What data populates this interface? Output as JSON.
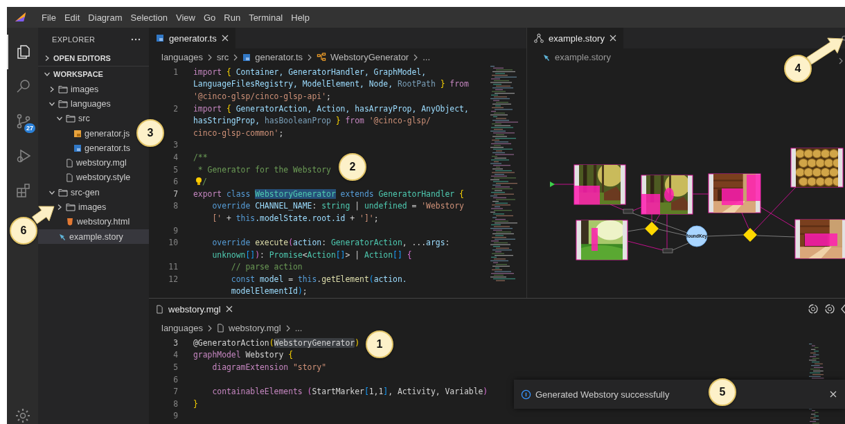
{
  "menu": [
    "File",
    "Edit",
    "Diagram",
    "Selection",
    "View",
    "Go",
    "Run",
    "Terminal",
    "Help"
  ],
  "activity": [
    {
      "kind": "files",
      "selected": true
    },
    {
      "kind": "search",
      "selected": false
    },
    {
      "kind": "scm",
      "selected": false,
      "badge": "27"
    },
    {
      "kind": "debug",
      "selected": false
    },
    {
      "kind": "extensions",
      "selected": false
    }
  ],
  "sidebar": {
    "title": "EXPLORER",
    "sections": [
      {
        "label": "OPEN EDITORS",
        "expanded": false
      },
      {
        "label": "WORKSPACE",
        "expanded": true,
        "items": [
          {
            "label": "images",
            "kind": "folder",
            "expanded": false,
            "selected": false
          },
          {
            "label": "languages",
            "kind": "folder",
            "expanded": true,
            "selected": false,
            "children": [
              {
                "label": "src",
                "kind": "folder",
                "expanded": true,
                "selected": false,
                "children": [
                  {
                    "label": "generator.js",
                    "kind": "js",
                    "selected": false
                  },
                  {
                    "label": "generator.ts",
                    "kind": "ts",
                    "selected": false
                  }
                ]
              },
              {
                "label": "webstory.mgl",
                "kind": "file",
                "selected": false
              },
              {
                "label": "webstory.style",
                "kind": "file",
                "selected": false
              }
            ]
          },
          {
            "label": "src-gen",
            "kind": "folder",
            "expanded": true,
            "selected": false,
            "children": [
              {
                "label": "images",
                "kind": "folder",
                "expanded": false,
                "selected": false
              },
              {
                "label": "webstory.html",
                "kind": "html",
                "selected": false
              }
            ]
          },
          {
            "label": "example.story",
            "kind": "story",
            "selected": true
          }
        ]
      }
    ]
  },
  "editor_groups": [
    {
      "tab": {
        "label": "generator.ts",
        "selected": true
      },
      "breadcrumbs": [
        {
          "label": "languages",
          "kind": "plain"
        },
        {
          "label": "src",
          "kind": "plain"
        },
        {
          "label": "generator.ts",
          "kind": "ts"
        },
        {
          "label": "WebstoryGenerator",
          "kind": "symbol"
        },
        {
          "label": "...",
          "kind": "plain"
        }
      ],
      "lines": [
        {
          "number": "1",
          "current": false,
          "rows": [
            {
              "tokens": [
                {
                  "text": "import ",
                  "kind": "kw"
                },
                {
                  "text": "{",
                  "kind": "br"
                },
                {
                  "text": " Container, GeneratorHandler, GraphModel,",
                  "kind": "var"
                }
              ]
            },
            {
              "tokens": [
                {
                  "text": "LanguageFilesRegistry, ModelElement, Node, ",
                  "kind": "var"
                },
                {
                  "text": "RootPath ",
                  "kind": "dim"
                },
                {
                  "text": "} ",
                  "kind": "br"
                },
                {
                  "text": "from",
                  "kind": "kw"
                }
              ]
            },
            {
              "tokens": [
                {
                  "text": "'@cinco-glsp/cinco-glsp-api'",
                  "kind": "str"
                },
                {
                  "text": ";",
                  "kind": "p"
                }
              ]
            }
          ]
        },
        {
          "number": "2",
          "current": false,
          "rows": [
            {
              "tokens": [
                {
                  "text": "import ",
                  "kind": "kw"
                },
                {
                  "text": "{",
                  "kind": "br"
                },
                {
                  "text": " GeneratorAction, Action, hasArrayProp, AnyObject,",
                  "kind": "var"
                }
              ]
            },
            {
              "tokens": [
                {
                  "text": "hasStringProp, ",
                  "kind": "var"
                },
                {
                  "text": "hasBooleanProp ",
                  "kind": "dim"
                },
                {
                  "text": "} ",
                  "kind": "br"
                },
                {
                  "text": "from",
                  "kind": "kw"
                },
                {
                  "text": " '@cinco-glsp/",
                  "kind": "str"
                }
              ]
            },
            {
              "tokens": [
                {
                  "text": "cinco-glsp-common'",
                  "kind": "str"
                },
                {
                  "text": ";",
                  "kind": "p"
                }
              ]
            }
          ]
        },
        {
          "number": "3",
          "current": false
        },
        {
          "number": "4",
          "current": false,
          "rows": [
            {
              "tokens": [
                {
                  "text": "/**",
                  "kind": "com"
                }
              ]
            }
          ]
        },
        {
          "number": "5",
          "current": false,
          "rows": [
            {
              "tokens": [
                {
                  "text": " * Generator for the Webstory",
                  "kind": "com"
                }
              ]
            }
          ]
        },
        {
          "number": "6",
          "current": false,
          "lightbulb": true,
          "rows": [
            {
              "tokens": [
                {
                  "text": "/",
                  "kind": "com"
                }
              ]
            }
          ]
        },
        {
          "number": "7",
          "current": true,
          "rows": [
            {
              "tokens": [
                {
                  "text": "export ",
                  "kind": "kw"
                },
                {
                  "text": "class ",
                  "kind": "decl"
                },
                {
                  "text": "WebstoryGenerator",
                  "kind": "match"
                },
                {
                  "text": " extends ",
                  "kind": "decl"
                },
                {
                  "text": "GeneratorHandler ",
                  "kind": "type"
                },
                {
                  "text": "{",
                  "kind": "br"
                }
              ]
            }
          ]
        },
        {
          "number": "8",
          "current": false,
          "rows": [
            {
              "tokens": [
                {
                  "text": "    override",
                  "kind": "decl"
                },
                {
                  "text": " CHANNEL_NAME",
                  "kind": "var"
                },
                {
                  "text": ": ",
                  "kind": "p"
                },
                {
                  "text": "string",
                  "kind": "type"
                },
                {
                  "text": " | ",
                  "kind": "p"
                },
                {
                  "text": "undefined",
                  "kind": "type"
                },
                {
                  "text": " = ",
                  "kind": "p"
                },
                {
                  "text": "'Webstory",
                  "kind": "str"
                }
              ]
            },
            {
              "tokens": [
                {
                  "text": "    ['",
                  "kind": "str"
                },
                {
                  "text": " + ",
                  "kind": "p"
                },
                {
                  "text": "this",
                  "kind": "decl"
                },
                {
                  "text": ".modelState.root.id",
                  "kind": "var"
                },
                {
                  "text": " + ",
                  "kind": "p"
                },
                {
                  "text": "']'",
                  "kind": "str"
                },
                {
                  "text": ";",
                  "kind": "p"
                }
              ]
            }
          ]
        },
        {
          "number": "9",
          "current": false
        },
        {
          "number": "10",
          "current": false,
          "rows": [
            {
              "tokens": [
                {
                  "text": "    override ",
                  "kind": "decl"
                },
                {
                  "text": "execute",
                  "kind": "fn"
                },
                {
                  "text": "(",
                  "kind": "br2"
                },
                {
                  "text": "action",
                  "kind": "var"
                },
                {
                  "text": ": ",
                  "kind": "p"
                },
                {
                  "text": "GeneratorAction",
                  "kind": "type"
                },
                {
                  "text": ", ...",
                  "kind": "p"
                },
                {
                  "text": "args",
                  "kind": "var"
                },
                {
                  "text": ":",
                  "kind": "p"
                }
              ]
            },
            {
              "tokens": [
                {
                  "text": "    unknown",
                  "kind": "type"
                },
                {
                  "text": "[]",
                  "kind": "br3"
                },
                {
                  "text": ")",
                  "kind": "br2"
                },
                {
                  "text": ": ",
                  "kind": "p"
                },
                {
                  "text": "Promise",
                  "kind": "type"
                },
                {
                  "text": "<",
                  "kind": "p"
                },
                {
                  "text": "Action",
                  "kind": "type"
                },
                {
                  "text": "[]",
                  "kind": "br3"
                },
                {
                  "text": "> | ",
                  "kind": "p"
                },
                {
                  "text": "Action",
                  "kind": "type"
                },
                {
                  "text": "[]",
                  "kind": "br3"
                },
                {
                  "text": " {",
                  "kind": "br2"
                }
              ]
            }
          ]
        },
        {
          "number": "11",
          "current": false,
          "rows": [
            {
              "tokens": [
                {
                  "text": "        // parse action",
                  "kind": "com"
                }
              ]
            }
          ]
        },
        {
          "number": "12",
          "current": false,
          "rows": [
            {
              "tokens": [
                {
                  "text": "        const ",
                  "kind": "decl"
                },
                {
                  "text": "model",
                  "kind": "var"
                },
                {
                  "text": " = ",
                  "kind": "p"
                },
                {
                  "text": "this",
                  "kind": "decl"
                },
                {
                  "text": ".",
                  "kind": "p"
                },
                {
                  "text": "getElement",
                  "kind": "fn"
                },
                {
                  "text": "(",
                  "kind": "br3"
                },
                {
                  "text": "action.",
                  "kind": "var"
                }
              ]
            },
            {
              "tokens": [
                {
                  "text": "        modelElementId",
                  "kind": "var"
                },
                {
                  "text": ")",
                  "kind": "br3"
                },
                {
                  "text": ";",
                  "kind": "p"
                }
              ]
            }
          ]
        }
      ]
    },
    {
      "tab": {
        "label": "example.story",
        "selected": true
      },
      "breadcrumbs": [
        {
          "label": "example.story",
          "kind": "story"
        }
      ],
      "diagram": {
        "variable_label": "foundKey"
      }
    }
  ],
  "panel": {
    "tab": {
      "label": "webstory.mgl",
      "selected": true
    },
    "breadcrumbs": [
      {
        "label": "languages",
        "kind": "plain"
      },
      {
        "label": "webstory.mgl",
        "kind": "file"
      },
      {
        "label": "...",
        "kind": "plain"
      }
    ],
    "lines": [
      {
        "number": "3",
        "current": true,
        "rows": [
          {
            "tokens": [
              {
                "text": "@GeneratorAction",
                "kind": "p"
              },
              {
                "text": "(",
                "kind": "br"
              },
              {
                "text": "WebstoryGenerator",
                "kind": "match2"
              },
              {
                "text": ")",
                "kind": "br"
              }
            ]
          }
        ]
      },
      {
        "number": "4",
        "current": false,
        "rows": [
          {
            "tokens": [
              {
                "text": "graphModel",
                "kind": "kw"
              },
              {
                "text": " Webstory ",
                "kind": "p"
              },
              {
                "text": "{",
                "kind": "br"
              }
            ]
          }
        ]
      },
      {
        "number": "5",
        "current": false,
        "rows": [
          {
            "tokens": [
              {
                "text": "    diagramExtension ",
                "kind": "kw"
              },
              {
                "text": "\"story\"",
                "kind": "str"
              }
            ]
          }
        ]
      },
      {
        "number": "6",
        "current": false
      },
      {
        "number": "7",
        "current": false,
        "rows": [
          {
            "tokens": [
              {
                "text": "    containableElements ",
                "kind": "kw"
              },
              {
                "text": "(",
                "kind": "br2"
              },
              {
                "text": "StartMarker",
                "kind": "p"
              },
              {
                "text": "[",
                "kind": "br3"
              },
              {
                "text": "1,1",
                "kind": "p"
              },
              {
                "text": "]",
                "kind": "br3"
              },
              {
                "text": ", Activity, Variable",
                "kind": "p"
              },
              {
                "text": ")",
                "kind": "br2"
              }
            ]
          }
        ]
      },
      {
        "number": "8",
        "current": false,
        "rows": [
          {
            "tokens": [
              {
                "text": "}",
                "kind": "br"
              }
            ]
          }
        ]
      },
      {
        "number": "9",
        "current": false
      }
    ]
  },
  "notification": {
    "message": "Generated Webstory successfully"
  },
  "callouts": [
    {
      "number": "1",
      "arrow": false
    },
    {
      "number": "2",
      "arrow": false
    },
    {
      "number": "3",
      "arrow": false
    },
    {
      "number": "4",
      "arrow": true
    },
    {
      "number": "5",
      "arrow": false
    },
    {
      "number": "6",
      "arrow": true
    }
  ]
}
